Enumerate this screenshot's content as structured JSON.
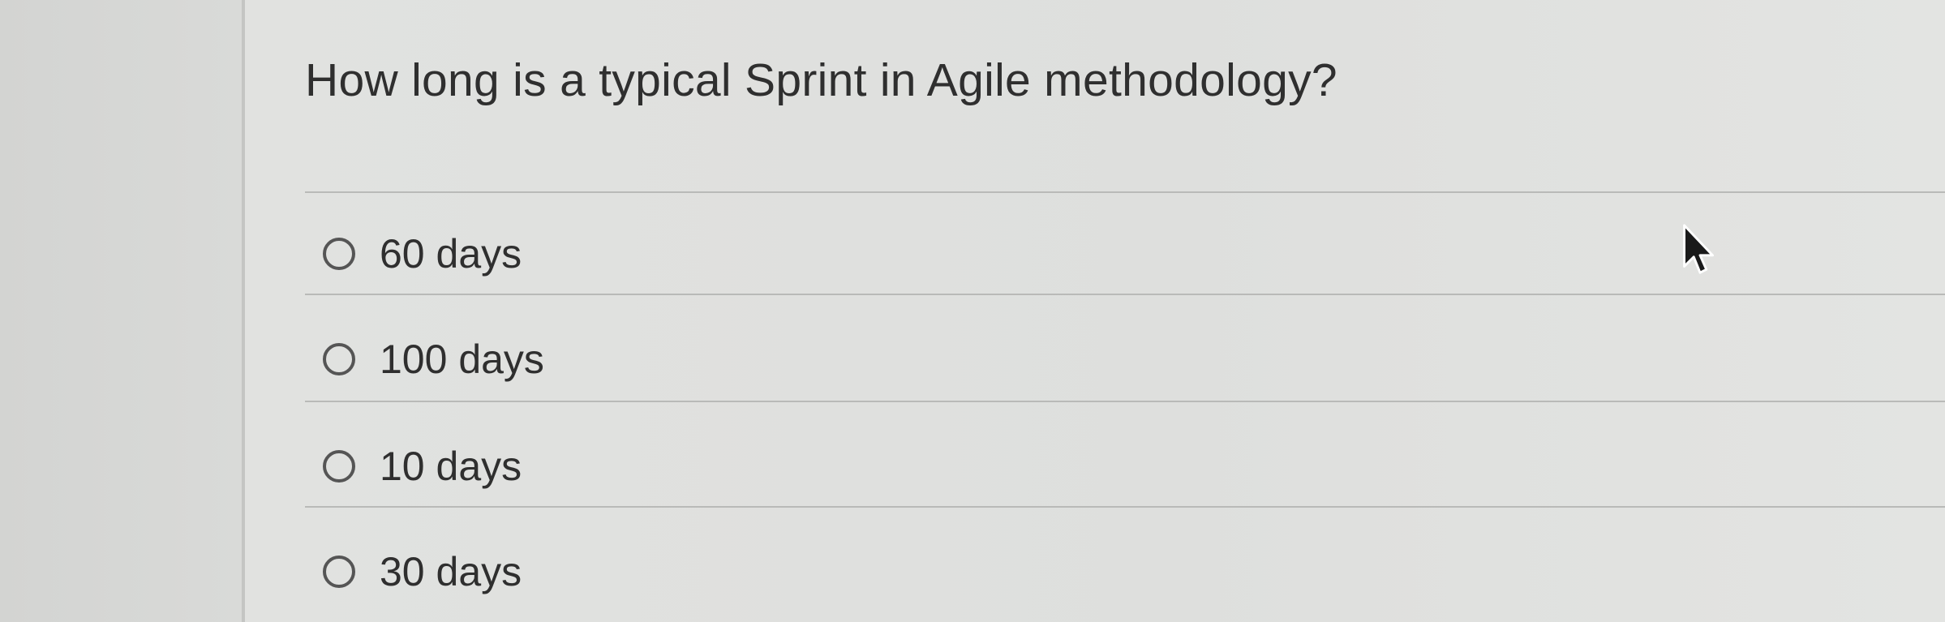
{
  "question": {
    "text": "How long is a typical Sprint in Agile methodology?"
  },
  "options": [
    {
      "label": "60 days",
      "selected": false
    },
    {
      "label": "100 days",
      "selected": false
    },
    {
      "label": "10 days",
      "selected": false
    },
    {
      "label": "30 days",
      "selected": false
    }
  ],
  "cursor": {
    "icon": "mouse-pointer-icon"
  },
  "colors": {
    "background": "#dcdddb",
    "text": "#2f2f2f",
    "divider": "#b9bab8",
    "radio_border": "#555555"
  }
}
